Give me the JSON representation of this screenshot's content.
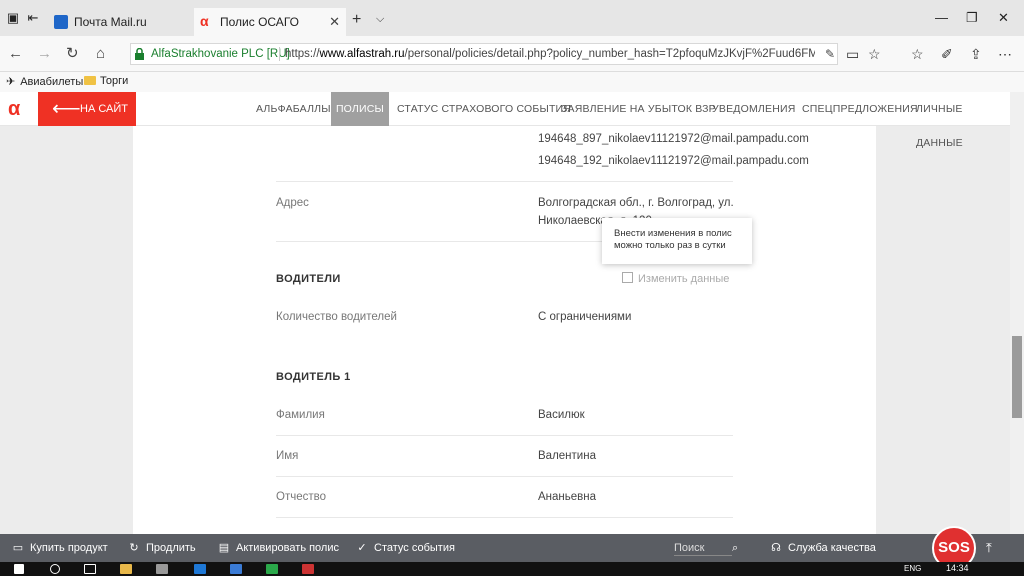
{
  "browser": {
    "tabs": [
      {
        "title": "Почта Mail.ru",
        "active": false
      },
      {
        "title": "Полис ОСАГО",
        "active": true
      }
    ],
    "tab_close_glyph": "✕",
    "new_tab_glyph": "+",
    "tab_menu_glyph": "⌵",
    "address": {
      "site_identity": "AlfaStrakhovanie PLC [RU]",
      "url_prefix": "https://",
      "url_domain": "www.alfastrah.ru",
      "url_path": "/personal/policies/detail.php?policy_number_hash=T2pfoquMzJKvjF%2Fuud6FMA%3D%3D#policyI"
    },
    "favorites": [
      {
        "label": "Авиабилеты",
        "icon": "plane-icon"
      },
      {
        "label": "Торги",
        "icon": "folder-icon"
      }
    ]
  },
  "site": {
    "back_label": "НА САЙТ",
    "menu": [
      {
        "label": "АЛЬФАБАЛЛЫ",
        "active": false
      },
      {
        "label": "ПОЛИСЫ",
        "active": true
      },
      {
        "label": "СТАТУС СТРАХОВОГО СОБЫТИЯ",
        "active": false
      },
      {
        "label": "ЗАЯВЛЕНИЕ НА УБЫТОК ВЗР",
        "active": false
      },
      {
        "label": "УВЕДОМЛЕНИЯ",
        "active": false
      },
      {
        "label": "СПЕЦПРЕДЛОЖЕНИЯ",
        "active": false
      },
      {
        "label": "ЛИЧНЫЕ ДАННЫЕ",
        "active": false
      }
    ]
  },
  "policy": {
    "emails": [
      "194648_897_nikolaev11121972@mail.pampadu.com",
      "194648_192_nikolaev11121972@mail.pampadu.com"
    ],
    "address_label": "Адрес",
    "address_value_line1": "Волгоградская обл., г. Волгоград, ул.",
    "address_value_line2": "Николаевская, д. 120",
    "tooltip_line1": "Внести изменения в полис",
    "tooltip_line2": "можно только раз в сутки",
    "drivers_heading": "ВОДИТЕЛИ",
    "edit_label": "Изменить данные",
    "drivers_count_label": "Количество водителей",
    "drivers_count_value": "С ограничениями",
    "driver1_heading": "ВОДИТЕЛЬ 1",
    "driver1": [
      {
        "label": "Фамилия",
        "value": "Василюк"
      },
      {
        "label": "Имя",
        "value": "Валентина"
      },
      {
        "label": "Отчество",
        "value": "Ананьевна"
      }
    ]
  },
  "bottom_bar": {
    "items": [
      {
        "label": "Купить продукт",
        "icon": "card-icon"
      },
      {
        "label": "Продлить",
        "icon": "renew-icon"
      },
      {
        "label": "Активировать полис",
        "icon": "document-icon"
      },
      {
        "label": "Статус события",
        "icon": "check-circle-icon"
      }
    ],
    "search_placeholder": "Поиск",
    "quality_label": "Служба качества",
    "sos_label": "SOS"
  },
  "taskbar": {
    "time": "14:34",
    "lang": "ENG"
  },
  "colors": {
    "brand_red": "#ef3124",
    "menu_active": "#a0a0a0",
    "bottom_bar": "#5a5d63",
    "site_identity_green": "#1a7f2e"
  }
}
